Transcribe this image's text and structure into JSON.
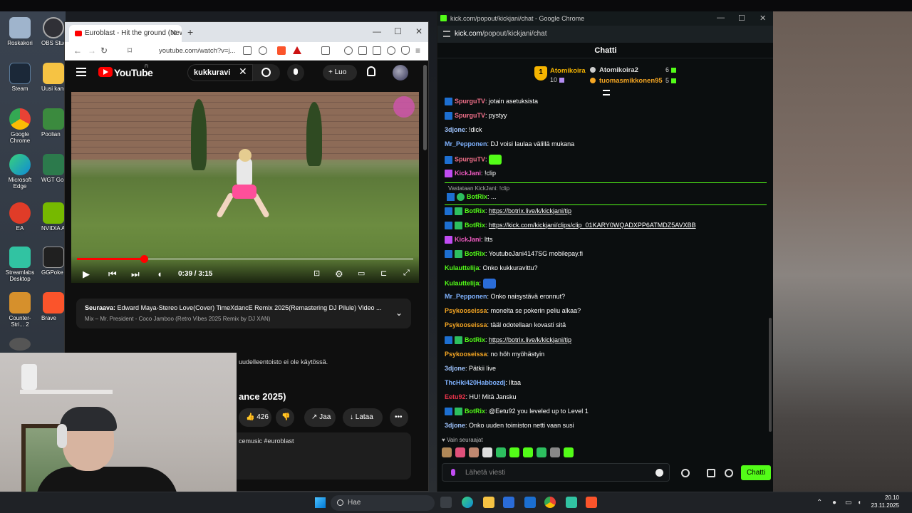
{
  "desktop": {
    "icons_left": [
      {
        "label": "Roskakori",
        "color": "#9fb4cc"
      },
      {
        "label": "Steam",
        "color": "#1b2838"
      },
      {
        "label": "Google Chrome",
        "color": "#e94235"
      },
      {
        "label": "Microsoft Edge",
        "color": "#0f8ad8"
      },
      {
        "label": "EA",
        "color": "#e03c28"
      },
      {
        "label": "Streamlabs Desktop",
        "color": "#31c3a2"
      },
      {
        "label": "Counter-Stri... 2",
        "color": "#d6902c"
      }
    ],
    "icons_col2": [
      {
        "label": "OBS Studi",
        "color": "#303036"
      },
      {
        "label": "Uusi kans",
        "color": "#f6c343"
      },
      {
        "label": "Poolian",
        "color": "#3b8a3e"
      },
      {
        "label": "WGT Go",
        "color": "#2c7a4c"
      },
      {
        "label": "NVIDIA A",
        "color": "#76b900"
      },
      {
        "label": "GGPoke",
        "color": "#202020"
      },
      {
        "label": "Brave",
        "color": "#fb542b"
      }
    ]
  },
  "youtube_window": {
    "tab_title": "Euroblast - Hit the ground (New",
    "url": "youtube.com/watch?v=j...",
    "search_query": "kukkuravi",
    "create_label": "Luo",
    "logo_text": "YouTube",
    "logo_region": "FI",
    "player": {
      "time": "0:39 / 3:15",
      "progress_fraction": 0.2
    },
    "next_up": {
      "label": "Seuraava:",
      "title": "Edward Maya-Stereo Love(Cover) TimeXdancE Remix 2025(Remastering DJ Pilule) Video ...",
      "mix": "Mix – Mr. President - Coco Jamboo (Retro Vibes 2025 Remix by DJ XAN)"
    },
    "notice": "uudelleentoisto ei ole käytössä.",
    "title_fragment": "ance 2025)",
    "like_count": "426",
    "share_label": "Jaa",
    "download_label": "Lataa",
    "description": "cemusic #euroblast"
  },
  "kick_window": {
    "title": "kick.com/popout/kickjani/chat - Google Chrome",
    "url_host": "kick.com",
    "url_path": "/popout/kickjani/chat",
    "header": "Chatti",
    "leaderboard": {
      "first": {
        "rank": "1",
        "name": "Atomikoira",
        "value": "10",
        "name_color": "#f5b400"
      },
      "second": {
        "name": "Atomikoira2",
        "value": "6",
        "name_color": "#dddddd"
      },
      "third": {
        "name": "tuomasmikkonen95",
        "value": "5",
        "name_color": "#f5a623"
      }
    },
    "messages": [
      {
        "user": "SpurguTV",
        "color": "#f2708a",
        "badges": [
          "bot"
        ],
        "text": "jotain asetuksista"
      },
      {
        "user": "SpurguTV",
        "color": "#f2708a",
        "badges": [
          "bot"
        ],
        "text": "pystyy"
      },
      {
        "user": "3djone",
        "color": "#9fc4ff",
        "badges": [],
        "text": "!dick"
      },
      {
        "user": "Mr_Pepponen",
        "color": "#7fb2ff",
        "badges": [],
        "text": "DJ voisi laulaa välillä mukana"
      },
      {
        "user": "SpurguTV",
        "color": "#f2708a",
        "badges": [
          "bot"
        ],
        "text": "",
        "emote": "#53fc18"
      },
      {
        "user": "KickJani",
        "color": "#f25cc4",
        "badges": [
          "mic"
        ],
        "text": "!clip"
      },
      {
        "user": "BotRix",
        "color": "#53fc18",
        "badges": [
          "bot",
          "ver"
        ],
        "text": "https://botrix.live/k/kickjani/tip",
        "link": true
      },
      {
        "user": "BotRix",
        "color": "#53fc18",
        "badges": [
          "bot",
          "ver"
        ],
        "text": "https://kick.com/kickjani/clips/clip_01KARY0WQADXPP6ATMDZ5AVXBB",
        "link": true
      },
      {
        "user": "KickJani",
        "color": "#f25cc4",
        "badges": [
          "mic"
        ],
        "text": "ltts"
      },
      {
        "user": "BotRix",
        "color": "#53fc18",
        "badges": [
          "bot",
          "ver"
        ],
        "text": "YoutubeJani4147SG mobilepay.fi"
      },
      {
        "user": "Kulauttelija",
        "color": "#53fc18",
        "badges": [],
        "text": "Onko kukkuravittu?"
      },
      {
        "user": "Kulauttelija",
        "color": "#53fc18",
        "badges": [],
        "text": "",
        "emote": "#2a6cd8"
      },
      {
        "user": "Mr_Pepponen",
        "color": "#7fb2ff",
        "badges": [],
        "text": "Onko naisystävä eronnut?"
      },
      {
        "user": "Psykooseissa",
        "color": "#f5a623",
        "badges": [],
        "text": "monelta se pokerin peliu alkaa?"
      },
      {
        "user": "Psykooseissa",
        "color": "#f5a623",
        "badges": [],
        "text": "tääl odotellaan kovasti sitä"
      },
      {
        "user": "BotRix",
        "color": "#53fc18",
        "badges": [
          "bot",
          "ver"
        ],
        "text": "https://botrix.live/k/kickjani/tip",
        "link": true
      },
      {
        "user": "Psykooseissa",
        "color": "#f5a623",
        "badges": [],
        "text": "no höh myöhästyin"
      },
      {
        "user": "3djone",
        "color": "#9fc4ff",
        "badges": [],
        "text": "Pätkii live"
      },
      {
        "user": "ThcHki420Habbozdj",
        "color": "#7fb2ff",
        "badges": [],
        "text": "lltaa"
      },
      {
        "user": "Eetu92",
        "color": "#e8334a",
        "badges": [],
        "text": "HU! Mitä Jansku"
      },
      {
        "user": "BotRix",
        "color": "#53fc18",
        "badges": [
          "bot",
          "ver"
        ],
        "text": "@Eetu92 you leveled up to Level 1"
      },
      {
        "user": "3djone",
        "color": "#9fc4ff",
        "badges": [],
        "text": "Onko uuden toimiston netti vaan susi"
      }
    ],
    "reply": {
      "label": "Vastataan KickJani: !clip",
      "user": "BotRix",
      "text": "...",
      "color": "#53fc18"
    },
    "followers_only": "Vain seuraajat",
    "input_placeholder": "Lähetä viesti",
    "send_label": "Chatti"
  },
  "taskbar": {
    "search_label": "Hae",
    "time": "20.10",
    "date": "23.11.2025"
  }
}
